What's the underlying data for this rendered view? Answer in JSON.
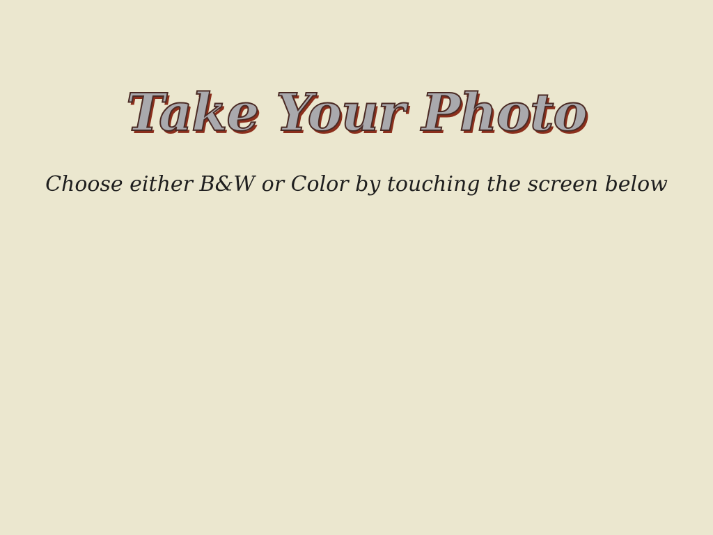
{
  "screen": {
    "title": "Take Your Photo",
    "subtitle": "Choose either B&W or Color by touching the screen below"
  },
  "colors": {
    "background": "#ebe7cf",
    "title_fill": "#a9a9ad",
    "title_shadow": "#8b2f1c",
    "subtitle_text": "#1e1e1e"
  }
}
